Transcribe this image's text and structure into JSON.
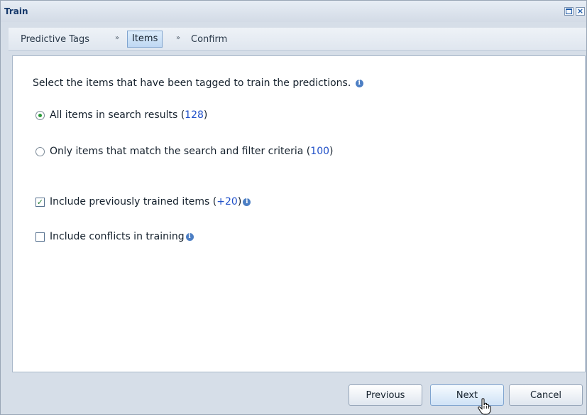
{
  "window": {
    "title": "Train"
  },
  "breadcrumb": {
    "step1": "Predictive Tags",
    "step2": "Items",
    "step3": "Confirm",
    "separator": "»"
  },
  "content": {
    "intro": "Select the items that have been tagged to train the predictions.",
    "radio_all": {
      "label": "All items in search results (",
      "count": "128",
      "suffix": ")",
      "selected": true
    },
    "radio_match": {
      "label": "Only items that match the search and filter criteria (",
      "count": "100",
      "suffix": ")",
      "selected": false
    },
    "check_previous": {
      "label": "Include previously trained items (",
      "count": "+20",
      "suffix": ")",
      "checked": true
    },
    "check_conflicts": {
      "label": "Include conflicts in training",
      "checked": false
    }
  },
  "footer": {
    "previous": "Previous",
    "next": "Next",
    "cancel": "Cancel"
  },
  "colors": {
    "accent": "#2050c8",
    "title": "#16396b",
    "panel": "#d6dee8"
  },
  "icons": [
    "maximize-icon",
    "close-icon",
    "info-icon",
    "hand-cursor-icon"
  ]
}
